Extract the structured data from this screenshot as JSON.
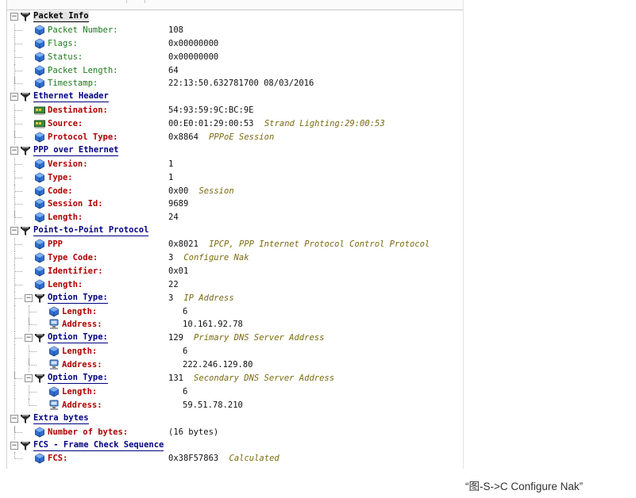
{
  "tree": {
    "rows": [
      {
        "depth": 0,
        "kind": "header",
        "icon": "filter-icon",
        "label": "Packet Info",
        "value": "",
        "desc": "",
        "first": true
      },
      {
        "depth": 1,
        "kind": "green",
        "icon": "cube-icon",
        "label": "Packet Number:",
        "value": "108",
        "desc": ""
      },
      {
        "depth": 1,
        "kind": "green",
        "icon": "cube-icon",
        "label": "Flags:",
        "value": "0x00000000",
        "desc": ""
      },
      {
        "depth": 1,
        "kind": "green",
        "icon": "cube-icon",
        "label": "Status:",
        "value": "0x00000000",
        "desc": ""
      },
      {
        "depth": 1,
        "kind": "green",
        "icon": "cube-icon",
        "label": "Packet Length:",
        "value": "64",
        "desc": ""
      },
      {
        "depth": 1,
        "kind": "green",
        "icon": "cube-icon",
        "label": "Timestamp:",
        "value": "22:13:50.632781700 08/03/2016",
        "desc": "",
        "last": true
      },
      {
        "depth": 0,
        "kind": "header",
        "icon": "filter-icon",
        "label": "Ethernet Header",
        "value": "",
        "desc": ""
      },
      {
        "depth": 1,
        "kind": "red",
        "icon": "network-card-icon",
        "label": "Destination:",
        "value": "54:93:59:9C:BC:9E",
        "desc": ""
      },
      {
        "depth": 1,
        "kind": "red",
        "icon": "network-card-icon",
        "label": "Source:",
        "value": "00:E0:01:29:00:53",
        "desc": "Strand Lighting:29:00:53"
      },
      {
        "depth": 1,
        "kind": "red",
        "icon": "cube-icon",
        "label": "Protocol Type:",
        "value": "0x8864",
        "desc": "PPPoE Session",
        "last": true
      },
      {
        "depth": 0,
        "kind": "header",
        "icon": "filter-icon",
        "label": "PPP over Ethernet",
        "value": "",
        "desc": ""
      },
      {
        "depth": 1,
        "kind": "red",
        "icon": "cube-icon",
        "label": "Version:",
        "value": "1",
        "desc": ""
      },
      {
        "depth": 1,
        "kind": "red",
        "icon": "cube-icon",
        "label": "Type:",
        "value": "1",
        "desc": ""
      },
      {
        "depth": 1,
        "kind": "red",
        "icon": "cube-icon",
        "label": "Code:",
        "value": "0x00",
        "desc": "Session"
      },
      {
        "depth": 1,
        "kind": "red",
        "icon": "cube-icon",
        "label": "Session Id:",
        "value": "9689",
        "desc": ""
      },
      {
        "depth": 1,
        "kind": "red",
        "icon": "cube-icon",
        "label": "Length:",
        "value": "24",
        "desc": "",
        "last": true
      },
      {
        "depth": 0,
        "kind": "header",
        "icon": "filter-icon",
        "label": "Point-to-Point Protocol",
        "value": "",
        "desc": ""
      },
      {
        "depth": 1,
        "kind": "red",
        "icon": "cube-icon",
        "label": "PPP",
        "value": "0x8021",
        "desc": "IPCP, PPP Internet Protocol Control Protocol"
      },
      {
        "depth": 1,
        "kind": "red",
        "icon": "cube-icon",
        "label": "Type Code:",
        "value": "3",
        "desc": "Configure Nak"
      },
      {
        "depth": 1,
        "kind": "red",
        "icon": "cube-icon",
        "label": "Identifier:",
        "value": "0x01",
        "desc": ""
      },
      {
        "depth": 1,
        "kind": "red",
        "icon": "cube-icon",
        "label": "Length:",
        "value": "22",
        "desc": ""
      },
      {
        "depth": 1,
        "kind": "header",
        "icon": "filter-icon",
        "label": "Option Type:",
        "value": "3",
        "desc": "IP Address"
      },
      {
        "depth": 2,
        "kind": "red",
        "icon": "cube-icon",
        "label": "Length:",
        "value": "6",
        "desc": ""
      },
      {
        "depth": 2,
        "kind": "red",
        "icon": "address-icon",
        "label": "Address:",
        "value": "10.161.92.78",
        "desc": "",
        "last": true
      },
      {
        "depth": 1,
        "kind": "header",
        "icon": "filter-icon",
        "label": "Option Type:",
        "value": "129",
        "desc": "Primary DNS Server Address"
      },
      {
        "depth": 2,
        "kind": "red",
        "icon": "cube-icon",
        "label": "Length:",
        "value": "6",
        "desc": ""
      },
      {
        "depth": 2,
        "kind": "red",
        "icon": "address-icon",
        "label": "Address:",
        "value": "222.246.129.80",
        "desc": "",
        "last": true
      },
      {
        "depth": 1,
        "kind": "header",
        "icon": "filter-icon",
        "label": "Option Type:",
        "value": "131",
        "desc": "Secondary DNS Server Address",
        "last": true
      },
      {
        "depth": 2,
        "kind": "red",
        "icon": "cube-icon",
        "label": "Length:",
        "value": "6",
        "desc": ""
      },
      {
        "depth": 2,
        "kind": "red",
        "icon": "address-icon",
        "label": "Address:",
        "value": "59.51.78.210",
        "desc": "",
        "last": true
      },
      {
        "depth": 0,
        "kind": "header",
        "icon": "filter-icon",
        "label": "Extra bytes",
        "value": "",
        "desc": ""
      },
      {
        "depth": 1,
        "kind": "red",
        "icon": "cube-icon",
        "label": "Number of bytes:",
        "value": "(16 bytes)",
        "desc": "",
        "last": true
      },
      {
        "depth": 0,
        "kind": "header",
        "icon": "filter-icon",
        "label": "FCS - Frame Check Sequence",
        "value": "",
        "desc": "",
        "last": true
      },
      {
        "depth": 1,
        "kind": "red",
        "icon": "cube-icon",
        "label": "FCS:",
        "value": "0x38F57863",
        "desc": "Calculated",
        "last": true
      }
    ]
  },
  "caption": "“图-S->C Configure Nak”",
  "colors": {
    "header": "#000080",
    "field_green": "#1a7a1a",
    "field_red": "#b00000",
    "description": "#7a6a10",
    "cube": "#2f6fd0"
  }
}
